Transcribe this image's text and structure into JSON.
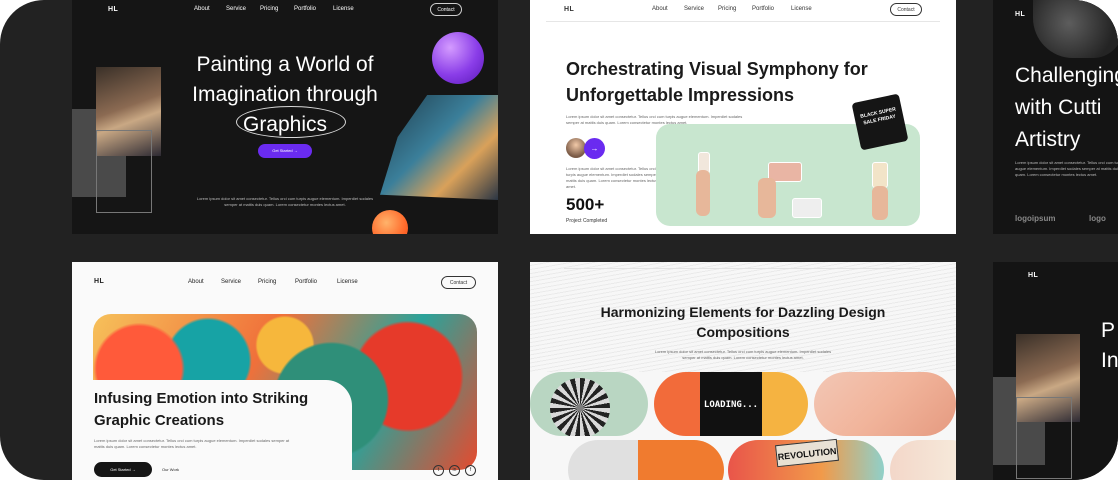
{
  "brand": "HL",
  "nav": [
    "About",
    "Service",
    "Pricing",
    "Portfolio",
    "License"
  ],
  "contact_label": "Contact",
  "lorem_short": "Lorem ipsum dolor sit amet consectetur. Tellus orci cum turpis augue elementum. Imperdiet sodales semper at mattis duis quam. Lorem consectetur montes lectus amet.",
  "card1": {
    "title_line1": "Painting a World of",
    "title_line2": "Imagination through",
    "title_line3": "Graphics",
    "cta": "Get Started →"
  },
  "card2": {
    "title": "Orchestrating Visual Symphony for Unforgettable Impressions",
    "stat_value": "500+",
    "stat_label": "Project Completed",
    "badge": "BLACK SUPER SALE FRIDAY",
    "arrow": "→"
  },
  "card3": {
    "title_line1": "Challenging",
    "title_line2": "with Cutti",
    "title_line3": "Artistry",
    "logo": "logoipsum",
    "logo2": "logo"
  },
  "card4": {
    "title": "Infusing Emotion into Striking Graphic Creations",
    "cta": "Get Started →",
    "secondary": "Our Work",
    "social": [
      "t",
      "in",
      "f"
    ]
  },
  "card5": {
    "title": "Harmonizing Elements for Dazzling Design Compositions",
    "loading": "LOADING...",
    "revolution": "REVOLUTION"
  },
  "card6": {
    "title_line1": "P",
    "title_line2": "In"
  },
  "colors": {
    "accent": "#6a2bf0",
    "dark_bg": "#151515",
    "mint": "#c8e6cf",
    "orange": "#ff6a2b"
  }
}
